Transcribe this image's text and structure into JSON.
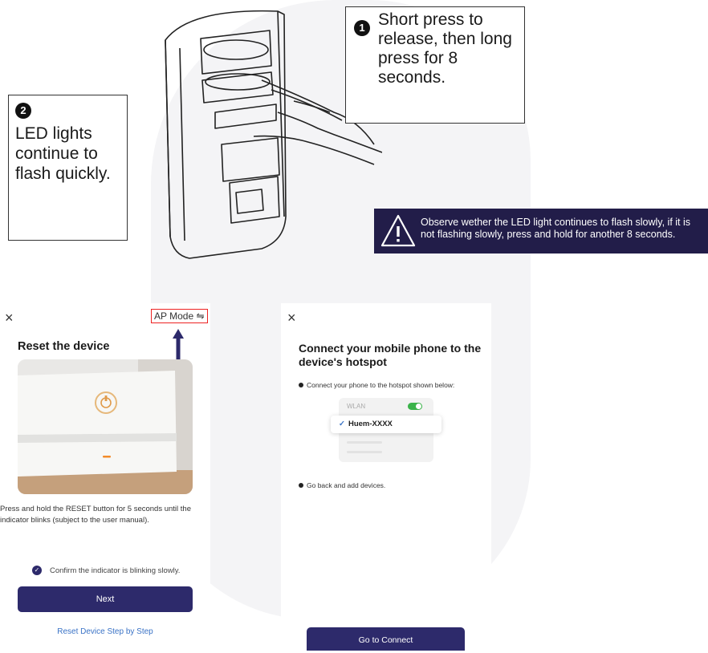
{
  "callout1": {
    "number": "1",
    "text": "Short press to release, then long press for 8 seconds."
  },
  "callout2": {
    "number": "2",
    "text": "LED lights continue to flash quickly."
  },
  "warning": {
    "text": "Observe wether the LED light continues to flash slowly, if it is not flashing slowly, press and hold for another 8 seconds."
  },
  "left_screen": {
    "close": "×",
    "ap_mode": "AP Mode ⇋",
    "title": "Reset the device",
    "description": "Press and hold the RESET button for 5 seconds until the indicator blinks (subject to the user manual).",
    "confirm": "Confirm the indicator is blinking slowly.",
    "next": "Next",
    "reset_link": "Reset Device Step by Step"
  },
  "right_screen": {
    "close": "×",
    "title": "Connect your mobile phone to the device's hotspot",
    "step1": "Connect your phone to the hotspot shown below:",
    "wlan_label": "WLAN",
    "ssid": "Huem-XXXX",
    "step2": "Go back and add devices.",
    "connect": "Go to Connect"
  },
  "colors": {
    "brand_navy": "#2d2a6b",
    "warning_bg": "#221d49",
    "link_blue": "#3a73c6",
    "highlight_red": "#e22222",
    "toggle_green": "#3bb34a"
  },
  "icons": [
    "close-icon",
    "swap-icon",
    "check-icon",
    "warning-icon",
    "power-icon"
  ]
}
